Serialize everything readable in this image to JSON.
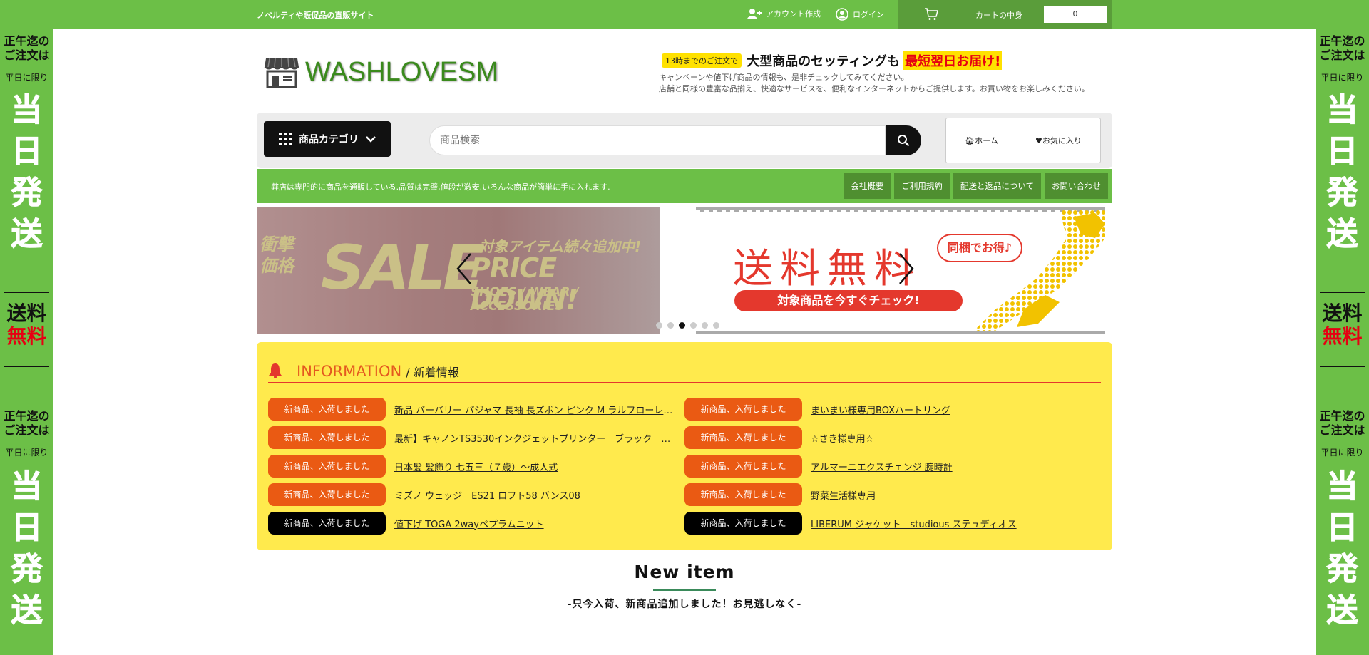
{
  "topbar": {
    "tagline": "ノベルティや販促品の直販サイト",
    "account_create": "アカウント作成",
    "login": "ログイン",
    "cart_label": "カートの中身",
    "cart_count": "0"
  },
  "side_banner": {
    "line1a": "正午迄の",
    "line1b": "ご注文は",
    "weekday": "平日に限り",
    "same_day": [
      "当",
      "日",
      "発",
      "送"
    ],
    "free_a": "送料",
    "free_b": "無料"
  },
  "header": {
    "logo": "WASHLOVESM",
    "promo_badge": "13時までのご注文で",
    "promo_main": "大型商品のセッティングも",
    "promo_highlight": "最短翌日お届け!",
    "promo_sub1": "キャンペーンや値下げ商品の情報も、是非チェックしてみてください。",
    "promo_sub2": "店舗と同様の豊富な品揃え、快適なサービスを、便利なインターネットからご提供します。お買い物をお楽しみください。"
  },
  "search": {
    "category_label": "商品カテゴリ",
    "placeholder": "商品検索",
    "nav_home": "ホーム",
    "nav_favorites": "お気に入り"
  },
  "greenbar": {
    "message": "弊店は専門的に商品を通販している.品質は完璧,値段が激安.いろんな商品が簡単に手に入れます.",
    "links": [
      "会社概要",
      "ご利用規約",
      "配送と返品について",
      "お問い合わせ"
    ]
  },
  "slider": {
    "slide1": {
      "shock": "衝撃価格",
      "sale": "SALE",
      "added": "対象アイテム続々追加中!",
      "price_down": "PRICE DOWN!",
      "categories": "SHOES / WEAR / ACCESSORIES"
    },
    "slide2": {
      "free_shipping": "送料無料",
      "bubble": "同梱でお得♪",
      "check": "対象商品を今すぐチェック!"
    },
    "dots": 6,
    "active_dot": 3
  },
  "info": {
    "title_en": "INFORMATION",
    "title_ja": "/ 新着情報",
    "tag_label": "新商品、入荷しました",
    "left": [
      "新品 バーバリー パジャマ 長袖 長ズボン ピンク M ラルフローレン…",
      "最新】キャノンTS3530インクジェットプリンター　ブラック　イ…",
      "日本髪 髪飾り 七五三（７歳）〜成人式",
      "ミズノ ウェッジ　ES21 ロフト58 バンス08",
      "値下げ TOGA 2wayペプラムニット"
    ],
    "right": [
      "まいまい様専用BOXハートリング",
      "☆さき様専用☆",
      "アルマーニエクスチェンジ 腕時計",
      "野菜生活様専用",
      "LIBERUM ジャケット　studious ステュディオス"
    ]
  },
  "new_item": {
    "heading": "New item",
    "subtitle": "-只今入荷、新商品追加しました！お見逃しなく-"
  },
  "colors": {
    "brand_green": "#6cbf47",
    "accent_orange": "#ea5a13",
    "info_yellow": "#ffea4d"
  }
}
